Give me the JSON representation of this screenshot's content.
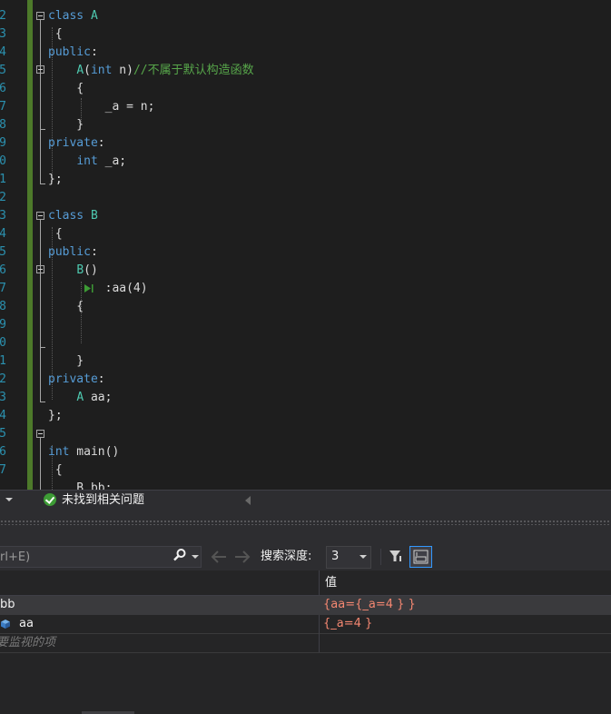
{
  "editor": {
    "line_numbers": [
      "2",
      "3",
      "4",
      "5",
      "6",
      "7",
      "8",
      "9",
      "0",
      "1",
      "2",
      "3",
      "4",
      "5",
      "6",
      "7",
      "8",
      "9",
      "0",
      "1",
      "2",
      "3",
      "4",
      "5",
      "6",
      "7"
    ],
    "lines": [
      [
        {
          "t": "class",
          "c": "kw"
        },
        {
          "t": " "
        },
        {
          "t": "A",
          "c": "ty"
        }
      ],
      [
        {
          "t": " {"
        }
      ],
      [
        {
          "t": "public",
          "c": "kw"
        },
        {
          "t": ":"
        }
      ],
      [
        {
          "t": "    "
        },
        {
          "t": "A",
          "c": "ty"
        },
        {
          "t": "("
        },
        {
          "t": "int",
          "c": "kw"
        },
        {
          "t": " n)"
        },
        {
          "t": "//不属于默认构造函数",
          "c": "cm"
        }
      ],
      [
        {
          "t": "    {"
        }
      ],
      [
        {
          "t": "        _a = n;"
        }
      ],
      [
        {
          "t": "    }"
        }
      ],
      [
        {
          "t": "private",
          "c": "kw"
        },
        {
          "t": ":"
        }
      ],
      [
        {
          "t": "    "
        },
        {
          "t": "int",
          "c": "kw"
        },
        {
          "t": " _a;"
        }
      ],
      [
        {
          "t": "};"
        }
      ],
      [
        {
          "t": ""
        }
      ],
      [
        {
          "t": "class",
          "c": "kw"
        },
        {
          "t": " "
        },
        {
          "t": "B",
          "c": "ty"
        }
      ],
      [
        {
          "t": " {"
        }
      ],
      [
        {
          "t": "public",
          "c": "kw"
        },
        {
          "t": ":"
        }
      ],
      [
        {
          "t": "    "
        },
        {
          "t": "B",
          "c": "ty"
        },
        {
          "t": "()"
        }
      ],
      [
        {
          "t": "        :aa(4)"
        }
      ],
      [
        {
          "t": "    {"
        }
      ],
      [
        {
          "t": ""
        }
      ],
      [
        {
          "t": ""
        }
      ],
      [
        {
          "t": "    }"
        }
      ],
      [
        {
          "t": "private",
          "c": "kw"
        },
        {
          "t": ":"
        }
      ],
      [
        {
          "t": "    "
        },
        {
          "t": "A",
          "c": "ty"
        },
        {
          "t": " aa;"
        }
      ],
      [
        {
          "t": "};"
        }
      ],
      [
        {
          "t": ""
        }
      ],
      [
        {
          "t": "int",
          "c": "kw"
        },
        {
          "t": " main()"
        }
      ],
      [
        {
          "t": " {"
        }
      ],
      [
        {
          "t": "    B bb;"
        }
      ]
    ]
  },
  "status_bar": {
    "issues_text": "未找到相关问题"
  },
  "watch_toolbar": {
    "search_value": "rl+E)",
    "depth_label": "搜索深度:",
    "depth_value": "3"
  },
  "watch_grid": {
    "columns": {
      "name": "",
      "value": "值"
    },
    "rows": [
      {
        "name": "bb",
        "value": "{aa={_a=4 } }"
      },
      {
        "name": "aa",
        "value": "{_a=4 }"
      }
    ],
    "add_hint": "要监视的项"
  },
  "colors": {
    "keyword": "#569cd6",
    "type": "#4ec9b0",
    "comment": "#57a64a",
    "value_text": "#f48771",
    "change_bar": "#4d7a2a"
  }
}
